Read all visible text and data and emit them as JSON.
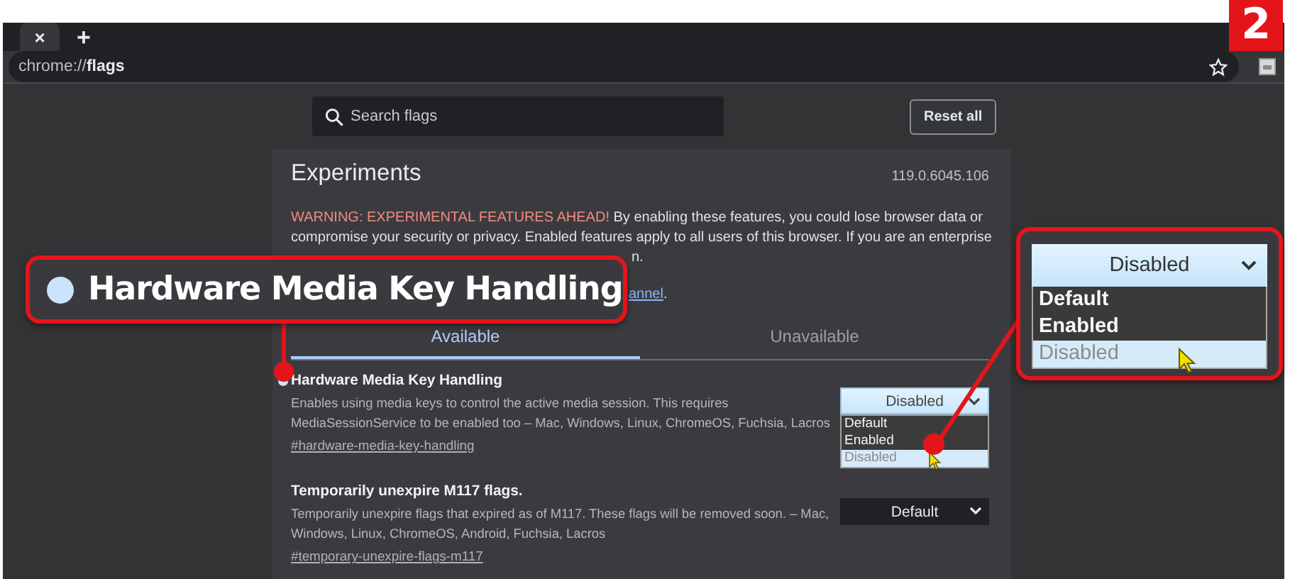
{
  "badge": "2",
  "tab_strip": {
    "tab_close": "×",
    "new_tab": "+"
  },
  "address_bar": {
    "url": "chrome://**flags**"
  },
  "search": {
    "placeholder": "Search flags"
  },
  "reset_button": "Reset all",
  "experiments": {
    "title": "Experiments",
    "version": "119.0.6045.106",
    "warning_label": "WARNING: EXPERIMENTAL FEATURES AHEAD!",
    "warning_lines": [
      "By enabling these features, you could lose browser data or",
      "compromise your security or privacy. Enabled features apply to all users of this browser. If you are an enterprise",
      "n."
    ],
    "link_fragment": "annel",
    "link_tail": "."
  },
  "tabs": [
    {
      "label": "Available",
      "selected": true
    },
    {
      "label": "Unavailable",
      "selected": false
    }
  ],
  "flags": [
    {
      "title": "Hardware Media Key Handling",
      "modified": true,
      "description_lines": [
        "Enables using media keys to control the active media session. This requires",
        "MediaSessionService to be enabled too – Mac, Windows, Linux, ChromeOS, Fuchsia, Lacros"
      ],
      "link": "#hardware-media-key-handling",
      "select": {
        "value": "Disabled",
        "open": true,
        "options": [
          {
            "label": "Default",
            "selected": false
          },
          {
            "label": "Enabled",
            "selected": false
          },
          {
            "label": "Disabled",
            "selected": true
          }
        ]
      }
    },
    {
      "title": "Temporarily unexpire M117 flags.",
      "modified": false,
      "description_lines": [
        "Temporarily unexpire flags that expired as of M117. These flags will be removed soon. – Mac,",
        "Windows, Linux, ChromeOS, Android, Fuchsia, Lacros"
      ],
      "link": "#temporary-unexpire-flags-m117",
      "select": {
        "value": "Default",
        "open": false
      }
    }
  ],
  "callouts": [
    {
      "kind": "title",
      "text": "Hardware Media Key Handling"
    },
    {
      "kind": "dropdown",
      "value": "Disabled",
      "options": [
        {
          "label": "Default",
          "selected": false
        },
        {
          "label": "Enabled",
          "selected": false
        },
        {
          "label": "Disabled",
          "selected": true
        }
      ]
    }
  ]
}
